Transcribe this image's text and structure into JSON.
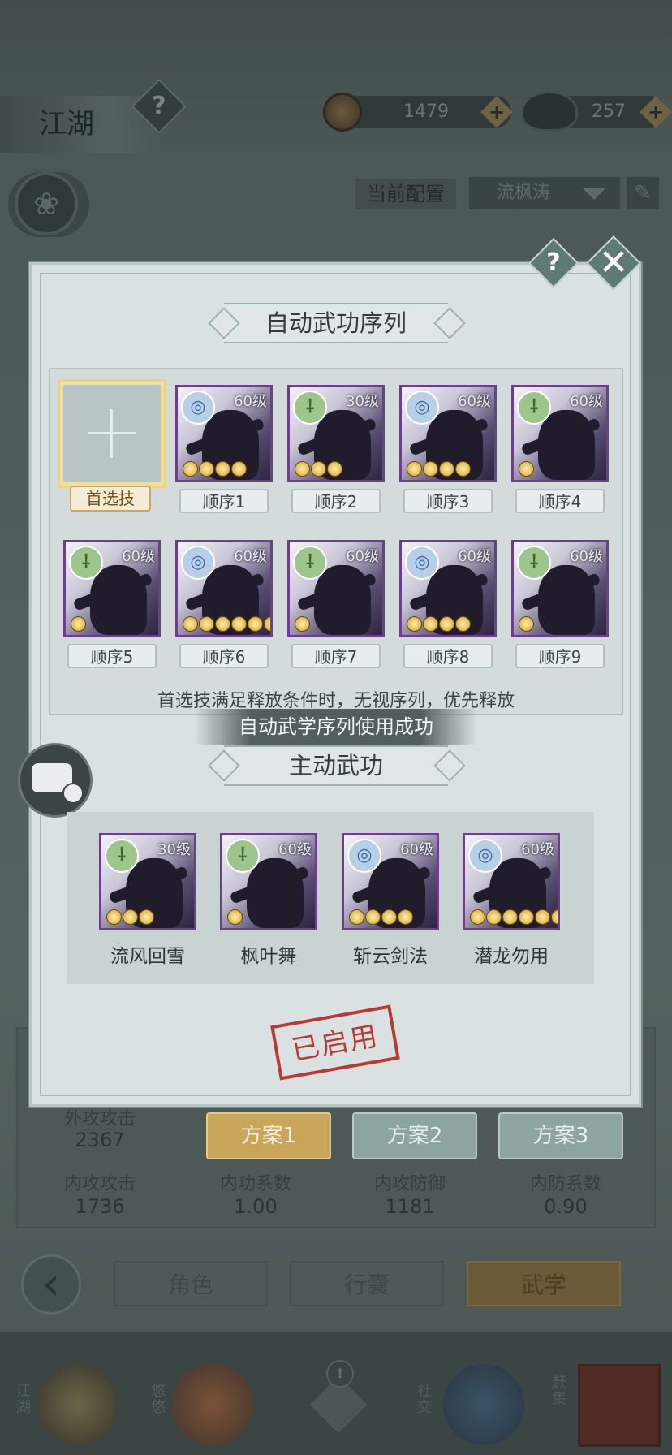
{
  "header": {
    "title": "江湖",
    "help_icon": "?",
    "copper": "1479",
    "silver": "257",
    "plus": "+"
  },
  "config": {
    "label": "当前配置",
    "selected": "流枫涛"
  },
  "modal": {
    "help_icon": "?",
    "close_icon": "✕",
    "sequence_title": "自动武功序列",
    "preferred_label": "首选技",
    "sequence_slots": [
      {
        "label": "顺序1",
        "level": "60级",
        "element": "water",
        "stars": 4
      },
      {
        "label": "顺序2",
        "level": "30级",
        "element": "wind",
        "stars": 3
      },
      {
        "label": "顺序3",
        "level": "60级",
        "element": "water",
        "stars": 4
      },
      {
        "label": "顺序4",
        "level": "60级",
        "element": "wind",
        "stars": 1
      },
      {
        "label": "顺序5",
        "level": "60级",
        "element": "wind",
        "stars": 1
      },
      {
        "label": "顺序6",
        "level": "60级",
        "element": "water",
        "stars": 6
      },
      {
        "label": "顺序7",
        "level": "60级",
        "element": "wind",
        "stars": 1
      },
      {
        "label": "顺序8",
        "level": "60级",
        "element": "water",
        "stars": 4
      },
      {
        "label": "顺序9",
        "level": "60级",
        "element": "wind",
        "stars": 1
      }
    ],
    "note": "首选技满足释放条件时，无视序列，优先释放",
    "toast": "自动武学序列使用成功",
    "active_title": "主动武功",
    "active_skills": [
      {
        "name": "流风回雪",
        "level": "30级",
        "element": "wind",
        "stars": 3
      },
      {
        "name": "枫叶舞",
        "level": "60级",
        "element": "wind",
        "stars": 1
      },
      {
        "name": "斩云剑法",
        "level": "60级",
        "element": "water",
        "stars": 4
      },
      {
        "name": "潜龙勿用",
        "level": "60级",
        "element": "water",
        "stars": 6
      }
    ],
    "stamp": "已启用"
  },
  "stats": {
    "row1": [
      {
        "label": "外攻攻击",
        "value": "2367"
      }
    ],
    "row2": [
      {
        "label": "内攻攻击",
        "value": "1736"
      },
      {
        "label": "内功系数",
        "value": "1.00"
      },
      {
        "label": "内攻防御",
        "value": "1181"
      },
      {
        "label": "内防系数",
        "value": "0.90"
      }
    ]
  },
  "plans": [
    "方案1",
    "方案2",
    "方案3"
  ],
  "nav": {
    "back_icon": "‹",
    "tabs": [
      "角色",
      "行囊",
      "武学"
    ]
  },
  "bottom": {
    "items": [
      "江湖",
      "悠悠",
      "社交",
      "赶集"
    ],
    "alert_icon": "!"
  },
  "colors": {
    "wind": "#9ec58c",
    "water": "#b8cfe8",
    "active_plan": "#c9a65a",
    "stamp": "#b83a36"
  }
}
